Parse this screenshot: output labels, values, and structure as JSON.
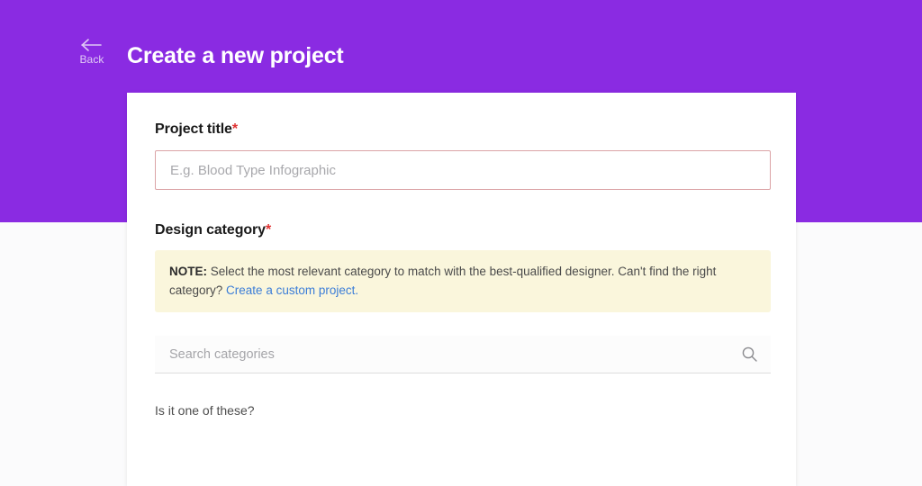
{
  "theme": {
    "brand_purple": "#8a2be2",
    "required_red": "#e03131",
    "error_border": "#dba3a6",
    "note_background": "#faf6dc",
    "link_blue": "#3b7dd8",
    "card_background": "#ffffff",
    "page_background": "#fbfbfc"
  },
  "header": {
    "back_label": "Back",
    "back_icon": "arrow-left-icon",
    "title": "Create a new project"
  },
  "form": {
    "project_title": {
      "label": "Project title",
      "required_marker": "*",
      "input_value": "",
      "placeholder": "E.g. Blood Type Infographic",
      "state": "error"
    },
    "design_category": {
      "label": "Design category",
      "required_marker": "*",
      "note": {
        "prefix": "NOTE:",
        "text": " Select the most relevant category to match with the best-qualified designer. Can't find the right category? ",
        "link_text": "Create a custom project.",
        "link_name": "create-custom-project-link"
      },
      "search": {
        "value": "",
        "placeholder": "Search categories",
        "icon": "search-icon"
      },
      "suggestions_prompt": "Is it one of these?"
    }
  }
}
